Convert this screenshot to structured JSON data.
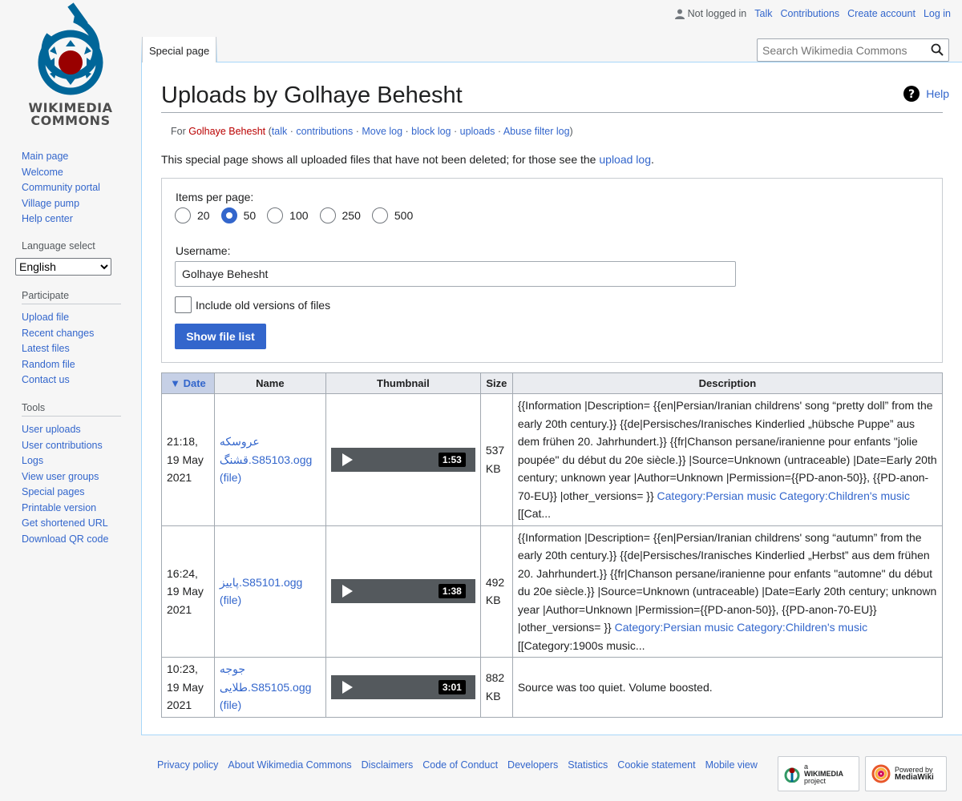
{
  "logo": {
    "line1": "WIKIMEDIA",
    "line2": "COMMONS"
  },
  "personal": {
    "not_logged_in": "Not logged in",
    "talk": "Talk",
    "contributions": "Contributions",
    "create_account": "Create account",
    "log_in": "Log in"
  },
  "tab": {
    "label": "Special page"
  },
  "search": {
    "placeholder": "Search Wikimedia Commons"
  },
  "sidebar": {
    "nav": [
      "Main page",
      "Welcome",
      "Community portal",
      "Village pump",
      "Help center"
    ],
    "language_heading": "Language select",
    "language_value": "English",
    "participate_heading": "Participate",
    "participate": [
      "Upload file",
      "Recent changes",
      "Latest files",
      "Random file",
      "Contact us"
    ],
    "tools_heading": "Tools",
    "tools": [
      "User uploads",
      "User contributions",
      "Logs",
      "View user groups",
      "Special pages",
      "Printable version",
      "Get shortened URL",
      "Download QR code"
    ]
  },
  "page": {
    "title": "Uploads by Golhaye Behesht",
    "help": "Help",
    "sub_for": "For",
    "sub_user": "Golhaye Behesht",
    "sub_links": [
      "talk",
      "contributions",
      "Move log",
      "block log",
      "uploads",
      "Abuse filter log"
    ],
    "intro": "This special page shows all uploaded files that have not been deleted; for those see the",
    "intro_link": "upload log",
    "intro_end": "."
  },
  "form": {
    "items_label": "Items per page:",
    "options": [
      "20",
      "50",
      "100",
      "250",
      "500"
    ],
    "selected": "50",
    "username_label": "Username:",
    "username_value": "Golhaye Behesht",
    "checkbox_label": "Include old versions of files",
    "submit": "Show file list"
  },
  "table": {
    "headers": [
      "Date",
      "Name",
      "Thumbnail",
      "Size",
      "Description"
    ],
    "rows": [
      {
        "date": "21:18, 19 May 2021",
        "name": "عروسکه قشنگ.S85103.ogg",
        "file": "(file)",
        "duration": "1:53",
        "size": "537 KB",
        "desc": "{{Information |Description= {{en|Persian/Iranian childrens' song “pretty doll” from the early 20th century.}} {{de|Persisches/Iranisches Kinderlied „hübsche Puppe” aus dem frühen 20. Jahrhundert.}} {{fr|Chanson persane/iranienne pour enfants \"jolie poupée\" du début du 20e siècle.}} |Source=Unknown (untraceable) |Date=Early 20th century; unknown year |Author=Unknown |Permission={{PD-anon-50}}, {{PD-anon-70-EU}} |other_versions= }}",
        "cat1": "Category:Persian music",
        "cat2": "Category:Children's music",
        "tail": "[[Cat..."
      },
      {
        "date": "16:24, 19 May 2021",
        "name": "پاییز.S85101.ogg",
        "file": "(file)",
        "duration": "1:38",
        "size": "492 KB",
        "desc": "{{Information |Description= {{en|Persian/Iranian childrens' song “autumn” from the early 20th century.}} {{de|Persisches/Iranisches Kinderlied „Herbst” aus dem frühen 20. Jahrhundert.}} {{fr|Chanson persane/iranienne pour enfants \"automne\" du début du 20e siècle.}} |Source=Unknown (untraceable) |Date=Early 20th century; unknown year |Author=Unknown |Permission={{PD-anon-50}}, {{PD-anon-70-EU}} |other_versions= }}",
        "cat1": "Category:Persian music",
        "cat2": "Category:Children's music",
        "tail": "[[Category:1900s music..."
      },
      {
        "date": "10:23, 19 May 2021",
        "name": "جوجه طلایی.S85105.ogg",
        "file": "(file)",
        "duration": "3:01",
        "size": "882 KB",
        "desc": "Source was too quiet. Volume boosted.",
        "cat1": "",
        "cat2": "",
        "tail": ""
      }
    ]
  },
  "footer": {
    "links": [
      "Privacy policy",
      "About Wikimedia Commons",
      "Disclaimers",
      "Code of Conduct",
      "Developers",
      "Statistics",
      "Cookie statement",
      "Mobile view"
    ],
    "badge1": [
      "a",
      "WIKIMEDIA",
      "project"
    ],
    "badge2": [
      "Powered by",
      "MediaWiki"
    ]
  },
  "colors": {
    "link": "#3366cc",
    "red_link": "#ba0000",
    "accent": "#3366cc",
    "logo_blue": "#006699",
    "logo_red": "#990000"
  }
}
